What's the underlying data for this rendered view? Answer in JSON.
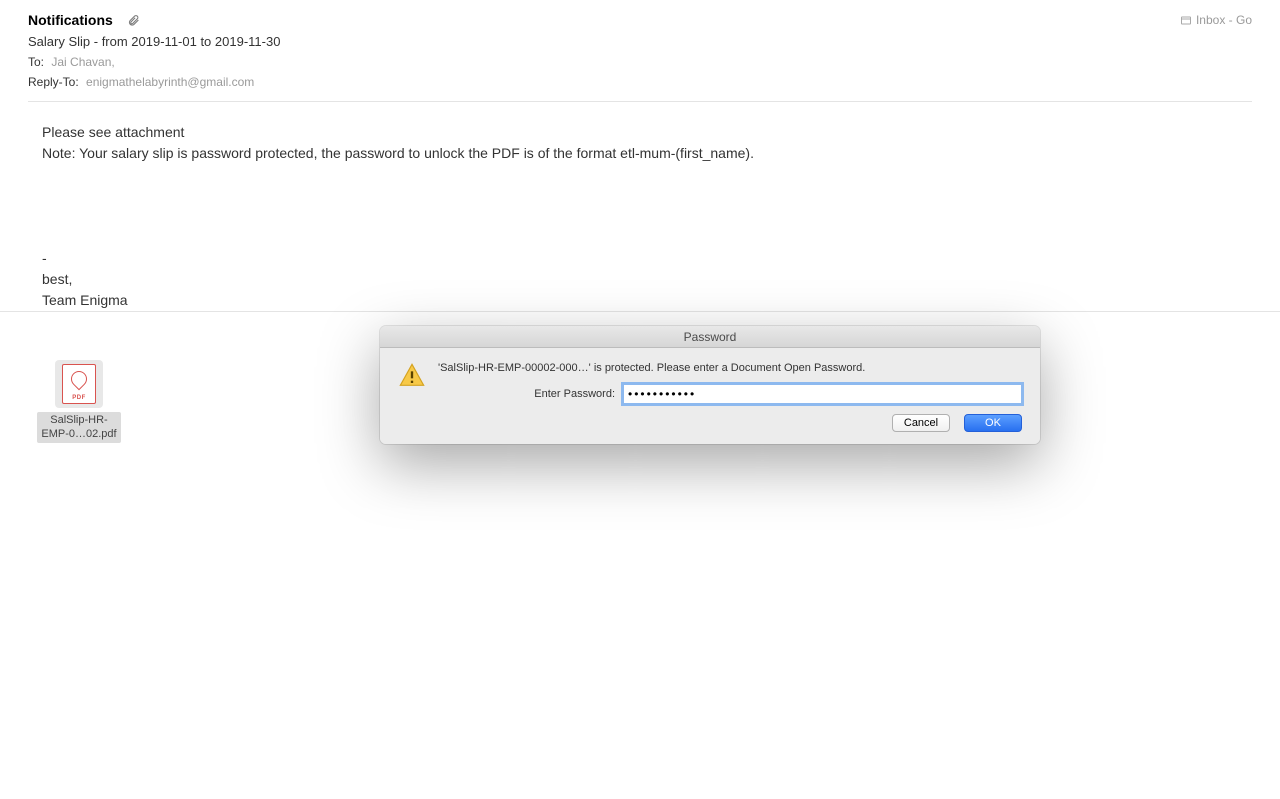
{
  "header": {
    "sender": "Notifications",
    "folder": "Inbox - Go",
    "subject": "Salary Slip - from 2019-11-01 to 2019-11-30",
    "to_label": "To:",
    "to_value": "Jai Chavan,",
    "reply_to_label": "Reply-To:",
    "reply_to_value": "enigmathelabyrinth@gmail.com"
  },
  "body": {
    "line1": "Please see attachment",
    "line2": "Note: Your salary slip is password protected, the password to unlock the PDF is of the format etl-mum-(first_name).",
    "sig_dash": "-",
    "sig_best": "best,",
    "sig_team": "Team Enigma"
  },
  "attachment": {
    "badge": "PDF",
    "name_line1": "SalSlip-HR-",
    "name_line2": "EMP-0…02.pdf"
  },
  "dialog": {
    "title": "Password",
    "message": "'SalSlip-HR-EMP-00002-000…' is protected. Please enter a Document Open Password.",
    "password_label": "Enter Password:",
    "password_value": "•••••••••••",
    "cancel": "Cancel",
    "ok": "OK"
  }
}
